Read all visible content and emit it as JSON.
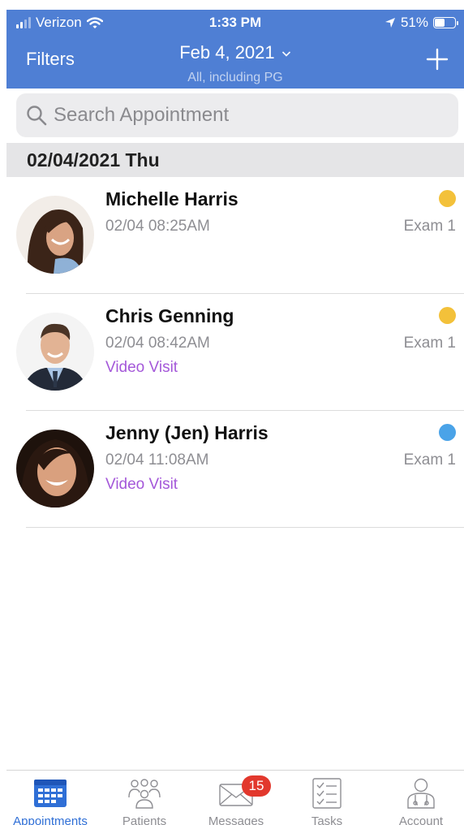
{
  "status_bar": {
    "carrier": "Verizon",
    "time": "1:33 PM",
    "battery_percent": "51%",
    "battery_level": 0.51
  },
  "header": {
    "filters_label": "Filters",
    "date": "Feb 4, 2021",
    "subtitle": "All, including PG",
    "add_icon": "plus-icon",
    "color": "#4f7fd4"
  },
  "search": {
    "placeholder": "Search Appointment",
    "icon": "search-icon"
  },
  "section": {
    "date_label": "02/04/2021 Thu"
  },
  "appointments": [
    {
      "name": "Michelle Harris",
      "time": "02/04 08:25AM",
      "visit_type": "",
      "room": "Exam 1",
      "status_color": "#f3c13a"
    },
    {
      "name": "Chris Genning",
      "time": "02/04 08:42AM",
      "visit_type": "Video Visit",
      "room": "Exam 1",
      "status_color": "#f3c13a"
    },
    {
      "name": "Jenny (Jen) Harris",
      "time": "02/04 11:08AM",
      "visit_type": "Video Visit",
      "room": "Exam 1",
      "status_color": "#4aa3e8"
    }
  ],
  "tabbar": {
    "tabs": [
      {
        "label": "Appointments",
        "icon": "calendar-icon",
        "active": true
      },
      {
        "label": "Patients",
        "icon": "patients-icon",
        "active": false
      },
      {
        "label": "Messages",
        "icon": "envelope-icon",
        "active": false,
        "badge": "15"
      },
      {
        "label": "Tasks",
        "icon": "checklist-icon",
        "active": false
      },
      {
        "label": "Account",
        "icon": "doctor-icon",
        "active": false
      }
    ],
    "active_color": "#2f6fd6"
  }
}
